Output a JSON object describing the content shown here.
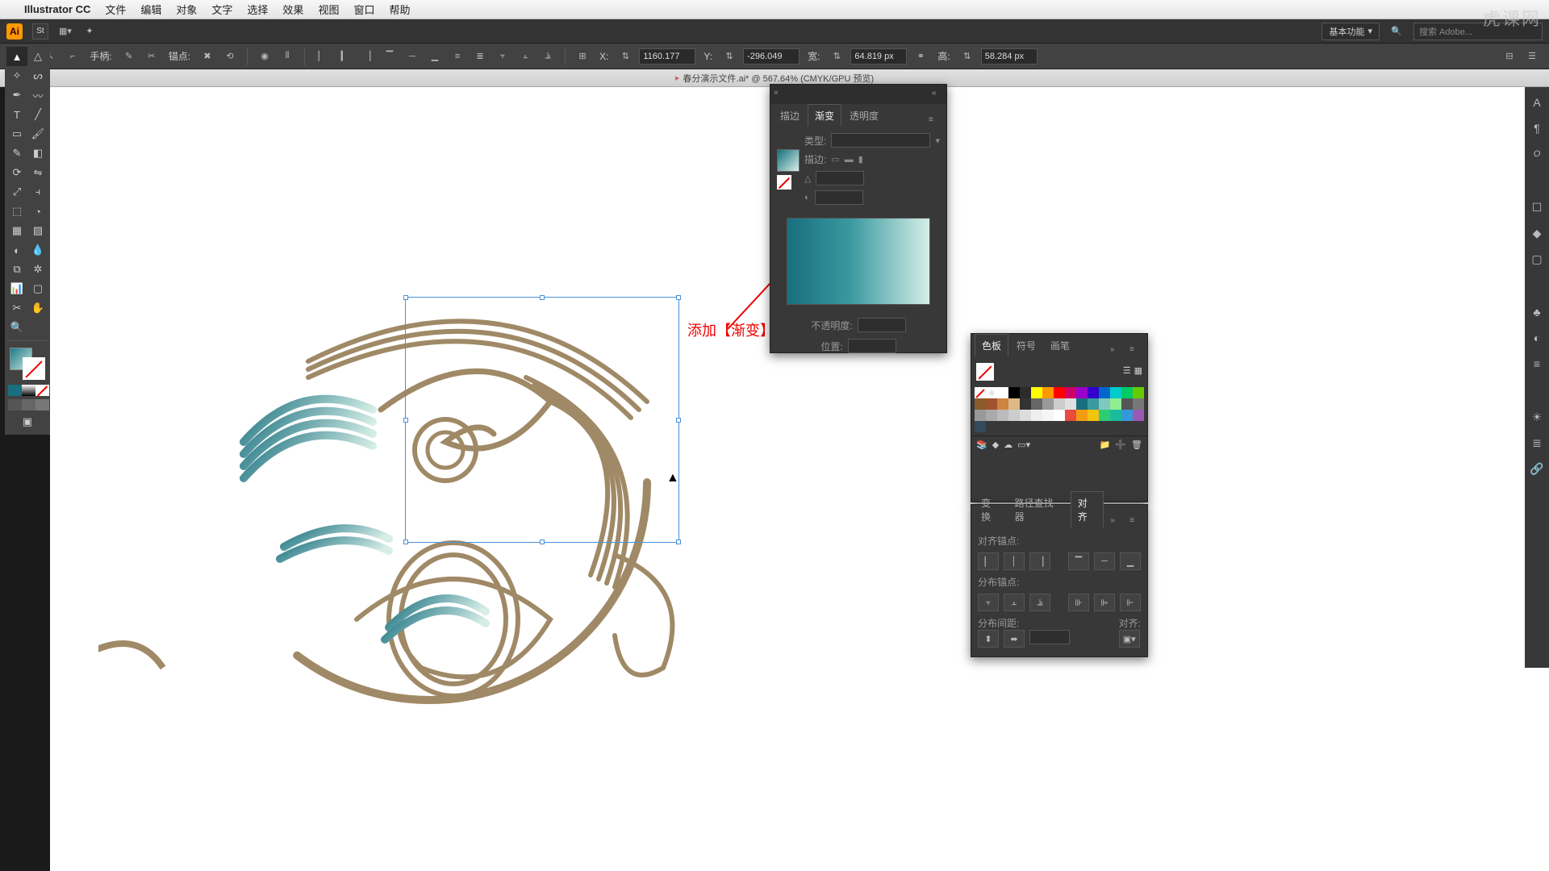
{
  "menubar": {
    "app_name": "Illustrator CC",
    "items": [
      "文件",
      "编辑",
      "对象",
      "文字",
      "选择",
      "效果",
      "视图",
      "窗口",
      "帮助"
    ]
  },
  "appbar": {
    "workspace": "基本功能",
    "search_placeholder": "搜索 Adobe..."
  },
  "controlbar": {
    "transform_label": "转换:",
    "handle_label": "手柄:",
    "anchor_label": "锚点:",
    "x_label": "X:",
    "x_value": "1160.177",
    "y_label": "Y:",
    "y_value": "-296.049",
    "w_label": "宽:",
    "w_value": "64.819 px",
    "h_label": "高:",
    "h_value": "58.284 px"
  },
  "doc_tab": "春分演示文件.ai* @ 567.64% (CMYK/GPU 预览)",
  "annotation_text": "添加【渐变】效果",
  "gradient_panel": {
    "tabs": [
      "描边",
      "渐变",
      "透明度"
    ],
    "active_tab": 1,
    "type_label": "类型:",
    "stroke_label": "描边:",
    "opacity_label": "不透明度:",
    "position_label": "位置:"
  },
  "swatches_panel": {
    "tabs": [
      "色板",
      "符号",
      "画笔"
    ],
    "active_tab": 0,
    "colors": [
      "#ffffff",
      "#000000",
      "#2b2b2b",
      "#ffff00",
      "#ff9900",
      "#ff0000",
      "#cc0066",
      "#9900cc",
      "#3300cc",
      "#0066cc",
      "#00cccc",
      "#00cc66",
      "#66cc00",
      "#8b5a2b",
      "#a0522d",
      "#cd853f",
      "#deb887",
      "#333333",
      "#666666",
      "#999999",
      "#cccccc",
      "#e0e0e0",
      "#186f7e",
      "#3a9aa0",
      "#7ec8c0",
      "#90ee90",
      "#555555",
      "#777777",
      "#999999",
      "#aaaaaa",
      "#bbbbbb",
      "#cccccc",
      "#dddddd",
      "#eeeeee",
      "#f5f5f5",
      "#ffffff",
      "#e74c3c",
      "#f39c12",
      "#f1c40f",
      "#2ecc71",
      "#1abc9c",
      "#3498db",
      "#9b59b6",
      "#34495e"
    ]
  },
  "align_panel": {
    "tabs": [
      "变换",
      "路径查找器",
      "对齐"
    ],
    "active_tab": 2,
    "align_anchor_label": "对齐锚点:",
    "dist_anchor_label": "分布锚点:",
    "dist_spacing_label": "分布间距:",
    "align_to_label": "对齐:"
  },
  "watermark": "虎课网"
}
